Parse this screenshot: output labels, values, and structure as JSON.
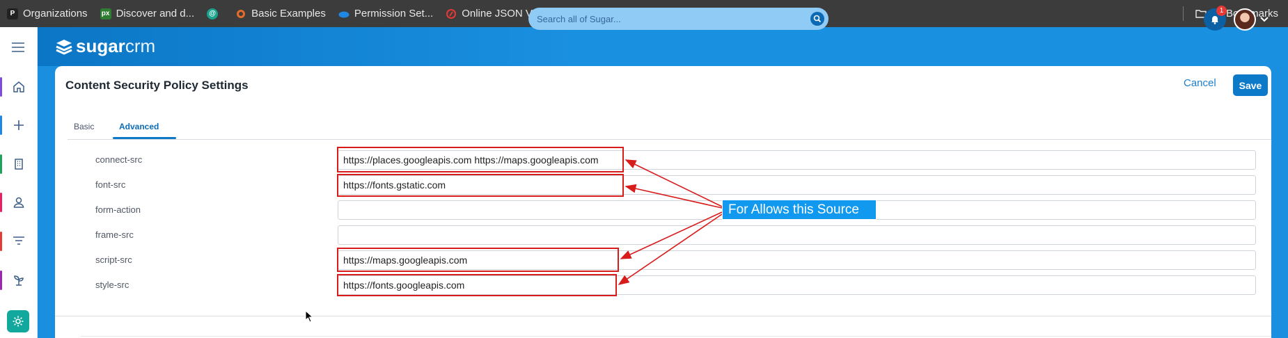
{
  "bookmarks": [
    {
      "label": "Organizations",
      "icon": "p-logo-icon",
      "color": "#222222"
    },
    {
      "label": "Discover and d...",
      "icon": "px-logo-icon",
      "color": "#2e7d32"
    },
    {
      "label": "",
      "icon": "swirl-logo-icon",
      "color": "#1aa38d"
    },
    {
      "label": "Basic Examples",
      "icon": "flame-logo-icon",
      "color": "#e46b2a"
    },
    {
      "label": "Permission Set...",
      "icon": "cloud-logo-icon",
      "color": "#1e88e5"
    },
    {
      "label": "Online JSON V...",
      "icon": "json-logo-icon",
      "color": "#e53935"
    }
  ],
  "all_bookmarks": "All Bookmarks",
  "header": {
    "logo_bold": "sugar",
    "logo_light": "crm",
    "search_placeholder": "Search all of Sugar...",
    "notification_count": "1"
  },
  "page": {
    "title": "Content Security Policy Settings",
    "cancel_label": "Cancel",
    "save_label": "Save",
    "tabs": [
      {
        "label": "Basic",
        "active": false
      },
      {
        "label": "Advanced",
        "active": true
      }
    ]
  },
  "fields": [
    {
      "label": "connect-src",
      "value": "https://places.googleapis.com https://maps.googleapis.com"
    },
    {
      "label": "font-src",
      "value": "https://fonts.gstatic.com"
    },
    {
      "label": "form-action",
      "value": ""
    },
    {
      "label": "frame-src",
      "value": ""
    },
    {
      "label": "script-src",
      "value": "https://maps.googleapis.com"
    },
    {
      "label": "style-src",
      "value": "https://fonts.googleapis.com"
    }
  ],
  "annotation": {
    "callout_text": "For Allows this Source",
    "highlight_color": "#d81b1b",
    "callout_color": "#1199f0"
  },
  "colors": {
    "brand": "#1a90e0",
    "accent": "#0c7ac9"
  }
}
